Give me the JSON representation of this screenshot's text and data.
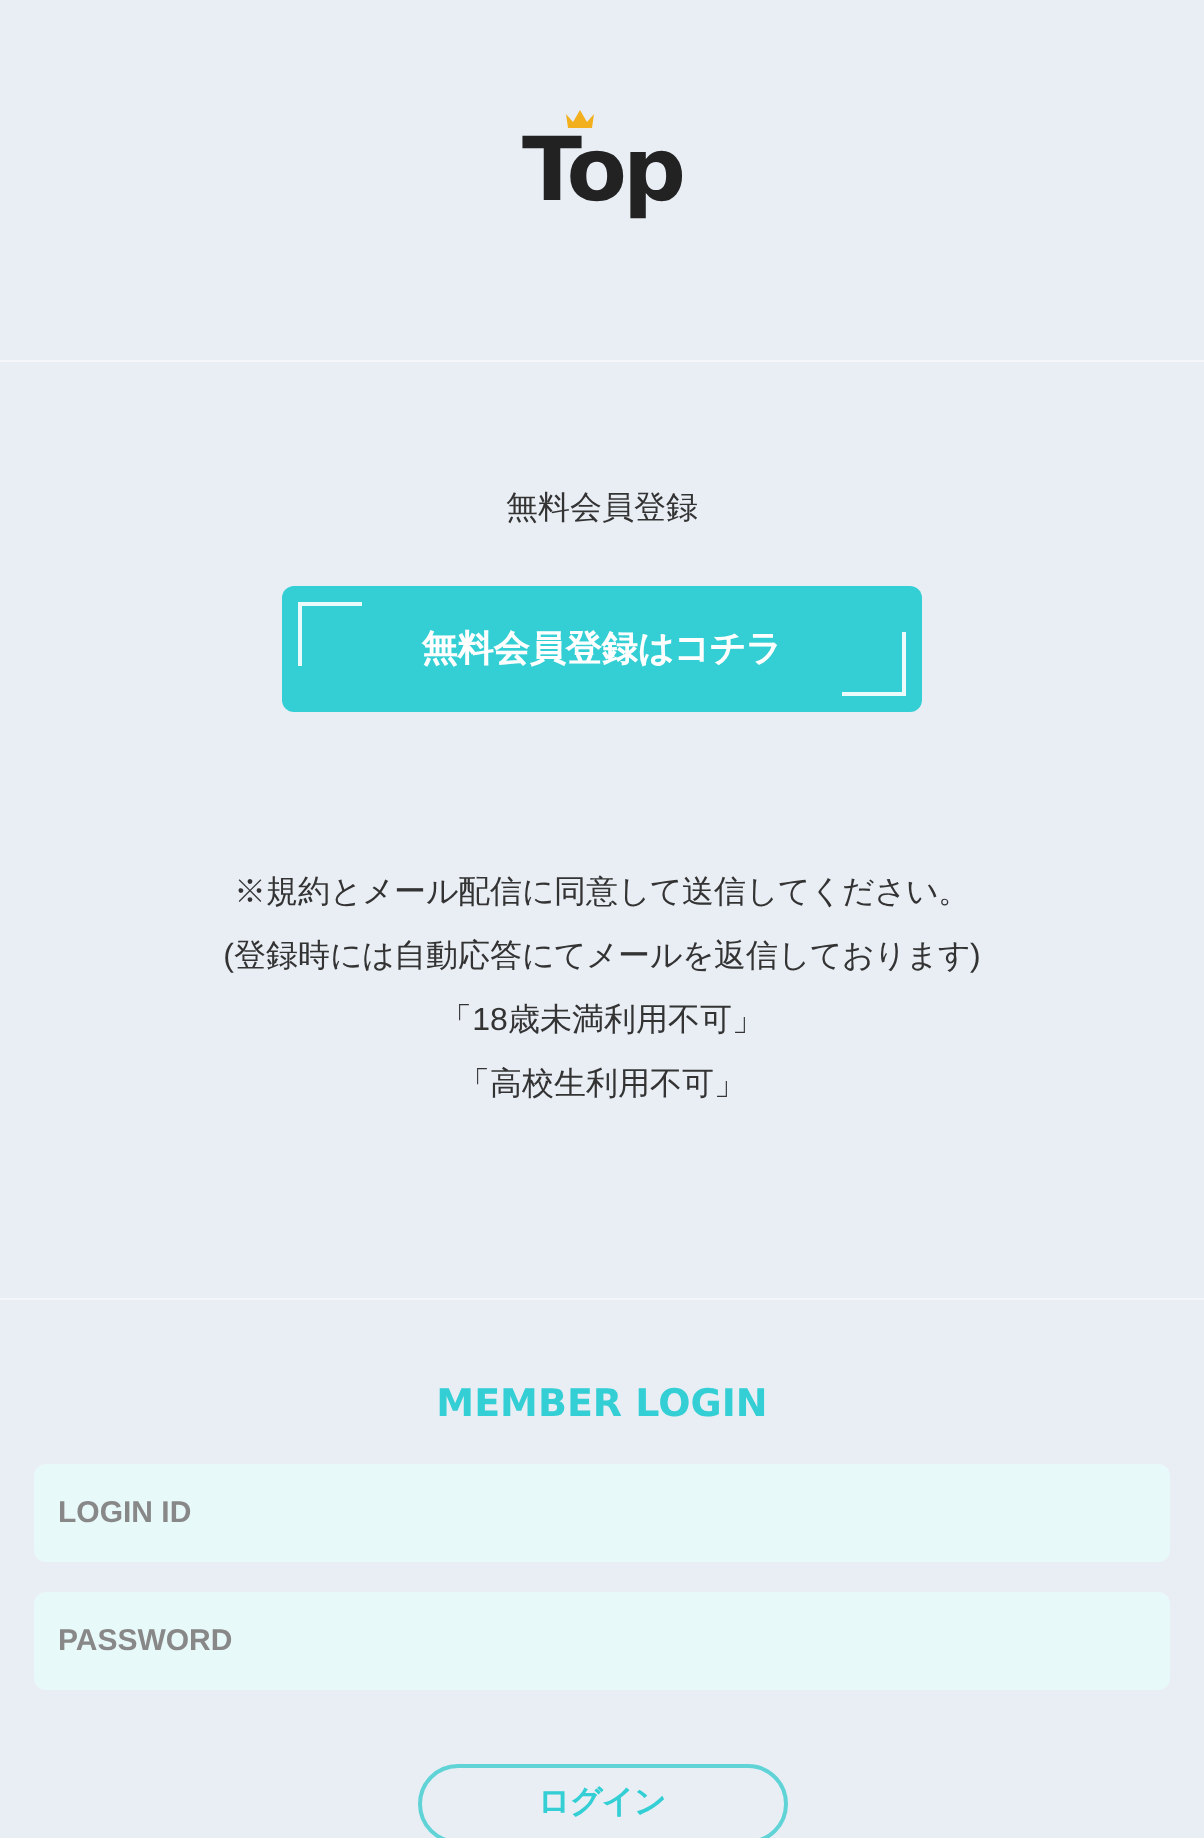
{
  "logo": {
    "text": "Top"
  },
  "register": {
    "title": "無料会員登録",
    "button": "無料会員登録はコチラ"
  },
  "notes": [
    "※規約とメール配信に同意して送信してください。",
    "(登録時には自動応答にてメールを返信しております)",
    "「18歳未満利用不可」",
    "「高校生利用不可」"
  ],
  "login": {
    "title": "MEMBER LOGIN",
    "fields": [
      {
        "placeholder": "LOGIN ID"
      },
      {
        "placeholder": "PASSWORD"
      }
    ],
    "button": "ログイン"
  }
}
